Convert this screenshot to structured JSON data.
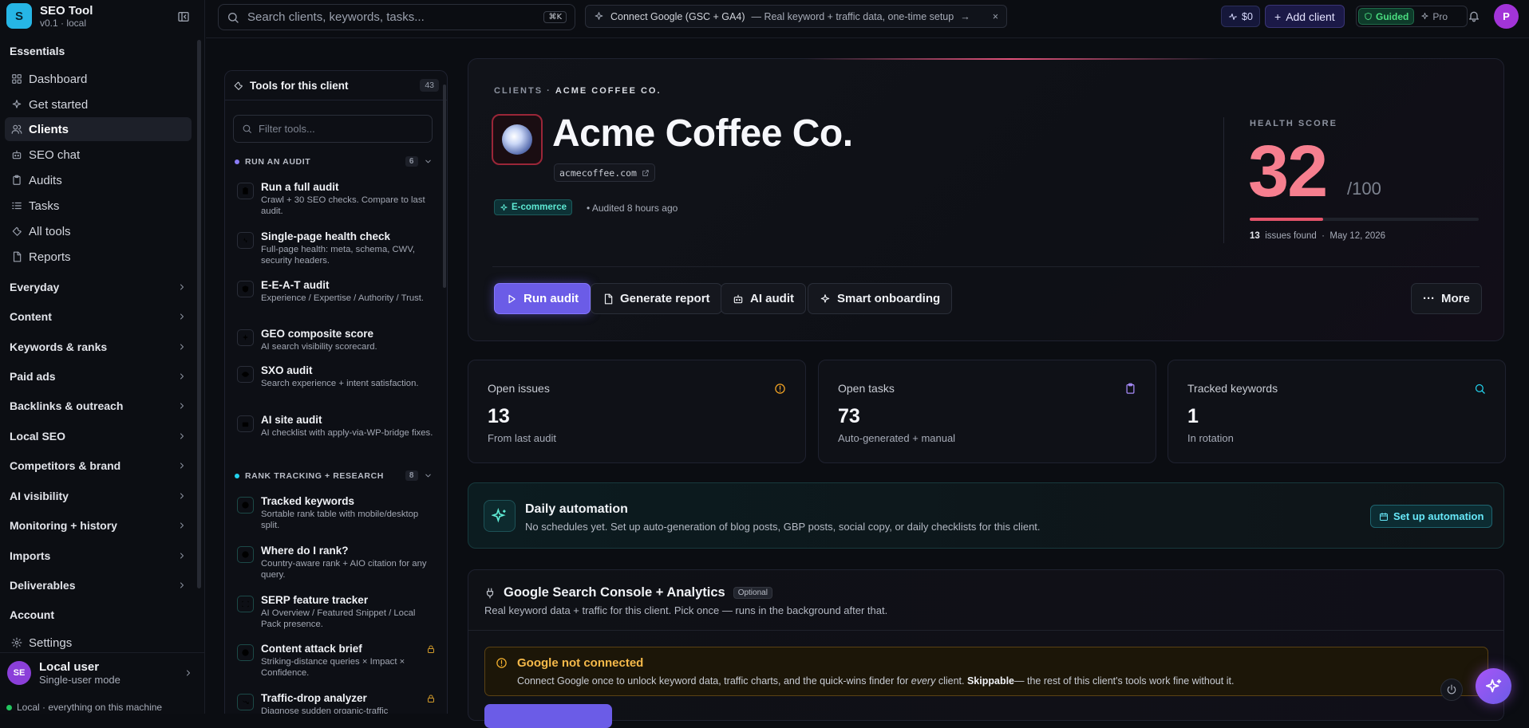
{
  "app": {
    "name": "SEO Tool",
    "version": "v0.1 · local",
    "logo_letter": "S"
  },
  "sidebar": {
    "essentials_heading": "Essentials",
    "items": [
      {
        "label": "Dashboard",
        "icon": "grid-icon"
      },
      {
        "label": "Get started",
        "icon": "sparkle-icon"
      },
      {
        "label": "Clients",
        "icon": "users-icon",
        "active": true
      },
      {
        "label": "SEO chat",
        "icon": "robot-icon"
      },
      {
        "label": "Audits",
        "icon": "clipboard-icon"
      },
      {
        "label": "Tasks",
        "icon": "list-icon"
      },
      {
        "label": "All tools",
        "icon": "wrench-icon"
      },
      {
        "label": "Reports",
        "icon": "document-icon"
      }
    ],
    "groups": [
      "Everyday",
      "Content",
      "Keywords & ranks",
      "Paid ads",
      "Backlinks & outreach",
      "Local SEO",
      "Competitors & brand",
      "AI visibility",
      "Monitoring + history",
      "Imports",
      "Deliverables"
    ],
    "account_heading": "Account",
    "settings_label": "Settings",
    "user": {
      "initials": "SE",
      "name": "Local user",
      "mode": "Single-user mode"
    },
    "status": "Local · everything on this machine"
  },
  "topbar": {
    "search_placeholder": "Search clients, keywords, tasks...",
    "search_kbd": "⌘K",
    "connect_title": "Connect Google (GSC + GA4)",
    "connect_sub": "— Real keyword + traffic data, one-time setup",
    "connect_arrow": "→",
    "connect_close": "×",
    "credits": "$0",
    "add_client": "Add client",
    "mode_on": "Guided",
    "mode_off": "Pro",
    "profile_initial": "P"
  },
  "tools": {
    "title": "Tools for this client",
    "count": "43",
    "filter_placeholder": "Filter tools...",
    "sections": [
      {
        "title": "RUN AN AUDIT",
        "count": "6",
        "color": "#8b7cf6",
        "items": [
          {
            "name": "Run a full audit",
            "desc": "Crawl + 30 SEO checks. Compare to last audit.",
            "icon": "clipboard-icon"
          },
          {
            "name": "Single-page health check",
            "desc": "Full-page health: meta, schema, CWV, security headers.",
            "icon": "pulse-icon"
          },
          {
            "name": "E-E-A-T audit",
            "desc": "Experience / Expertise / Authority / Trust.",
            "icon": "shield-icon"
          },
          {
            "name": "GEO composite score",
            "desc": "AI search visibility scorecard.",
            "icon": "sparkle-icon"
          },
          {
            "name": "SXO audit",
            "desc": "Search experience + intent satisfaction.",
            "icon": "eye-icon"
          },
          {
            "name": "AI site audit",
            "desc": "AI checklist with apply-via-WP-bridge fixes.",
            "icon": "robot-icon"
          }
        ]
      },
      {
        "title": "RANK TRACKING + RESEARCH",
        "count": "8",
        "color": "#22d3ee",
        "items": [
          {
            "name": "Tracked keywords",
            "desc": "Sortable rank table with mobile/desktop split.",
            "icon": "target-icon"
          },
          {
            "name": "Where do I rank?",
            "desc": "Country-aware rank + AIO citation for any query.",
            "icon": "compass-icon"
          },
          {
            "name": "SERP feature tracker",
            "desc": "AI Overview / Featured Snippet / Local Pack presence.",
            "icon": "scan-icon"
          },
          {
            "name": "Content attack brief",
            "desc": "Striking-distance queries × Impact × Confidence.",
            "icon": "target-icon",
            "locked": true
          },
          {
            "name": "Traffic-drop analyzer",
            "desc": "Diagnose sudden organic-traffic",
            "icon": "trend-down-icon",
            "locked": true
          }
        ]
      }
    ]
  },
  "client": {
    "breadcrumb_root": "CLIENTS",
    "breadcrumb_sep": "·",
    "breadcrumb_current": "ACME COFFEE CO.",
    "name": "Acme Coffee Co.",
    "domain": "acmecoffee.com",
    "tag": "E-commerce",
    "audited": "• Audited 8 hours ago",
    "health_label": "HEALTH SCORE",
    "health_score": "32",
    "health_max": "/100",
    "health_fraction": 0.32,
    "issues_count": "13",
    "issues_label": "issues found",
    "meta_sep": "·",
    "date": "May 12, 2026",
    "actions": {
      "run_audit": "Run audit",
      "generate_report": "Generate report",
      "ai_audit": "AI audit",
      "smart_onboarding": "Smart onboarding",
      "more": "More"
    }
  },
  "stats": [
    {
      "label": "Open issues",
      "value": "13",
      "sub": "From last audit",
      "icon": "alert-icon",
      "color": "#f5a524"
    },
    {
      "label": "Open tasks",
      "value": "73",
      "sub": "Auto-generated + manual",
      "icon": "clipboard-icon",
      "color": "#a78bfa"
    },
    {
      "label": "Tracked keywords",
      "value": "1",
      "sub": "In rotation",
      "icon": "search-icon",
      "color": "#22d3ee"
    }
  ],
  "automation": {
    "title": "Daily automation",
    "desc": "No schedules yet. Set up auto-generation of blog posts, GBP posts, social copy, or daily checklists for this client.",
    "button": "Set up automation"
  },
  "google": {
    "title": "Google Search Console + Analytics",
    "badge": "Optional",
    "desc": "Real keyword data + traffic for this client. Pick once — runs in the background after that.",
    "warn_title": "Google not connected",
    "warn_desc_a": "Connect Google once to unlock keyword data, traffic charts, and the quick-wins finder for ",
    "warn_desc_em": "every",
    "warn_desc_b": " client. ",
    "warn_desc_strong": "Skippable",
    "warn_desc_c": "— the rest of this client's tools work fine without it."
  },
  "colors": {
    "accent": "#6b5ce7",
    "health": "#f67f8f",
    "teal": "#5eead4",
    "warning": "#f5b94a"
  }
}
